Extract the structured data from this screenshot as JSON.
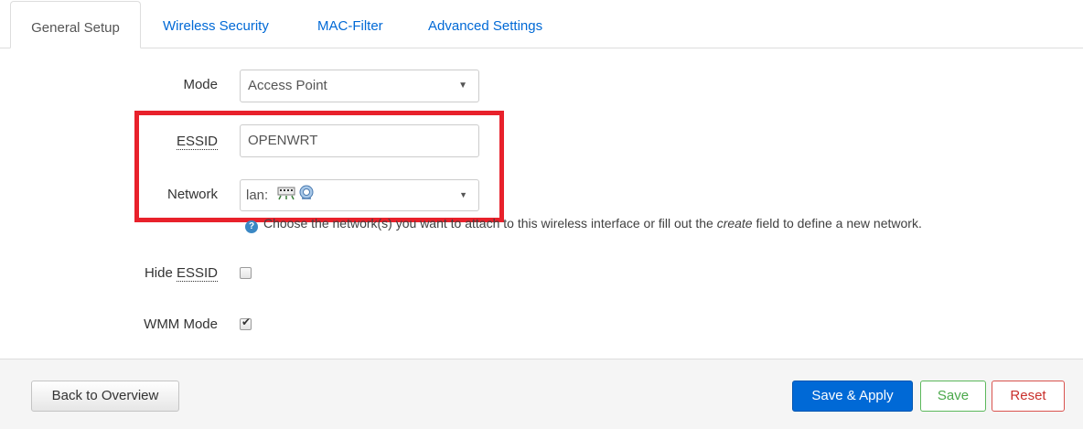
{
  "tabs": [
    {
      "label": "General Setup",
      "active": true
    },
    {
      "label": "Wireless Security",
      "active": false
    },
    {
      "label": "MAC-Filter",
      "active": false
    },
    {
      "label": "Advanced Settings",
      "active": false
    }
  ],
  "form": {
    "mode": {
      "label": "Mode",
      "value": "Access Point"
    },
    "essid": {
      "label": "ESSID",
      "value": "OPENWRT"
    },
    "network": {
      "label": "Network",
      "value": "lan:",
      "icons": [
        "ethernet-switch-icon",
        "wifi-icon"
      ]
    },
    "network_help": {
      "before": "Choose the network(s) you want to attach to this wireless interface or fill out the ",
      "em": "create",
      "after": " field to define a new network."
    },
    "hide_essid": {
      "label_prefix": "Hide ",
      "label_abbr": "ESSID",
      "checked": false
    },
    "wmm_mode": {
      "label": "WMM Mode",
      "checked": true
    }
  },
  "footer": {
    "back_label": "Back to Overview",
    "apply_label": "Save & Apply",
    "save_label": "Save",
    "reset_label": "Reset"
  },
  "colors": {
    "accent": "#0069d6",
    "highlight": "#e8212b",
    "save_green": "#5cb85c",
    "reset_red": "#d9534f"
  }
}
